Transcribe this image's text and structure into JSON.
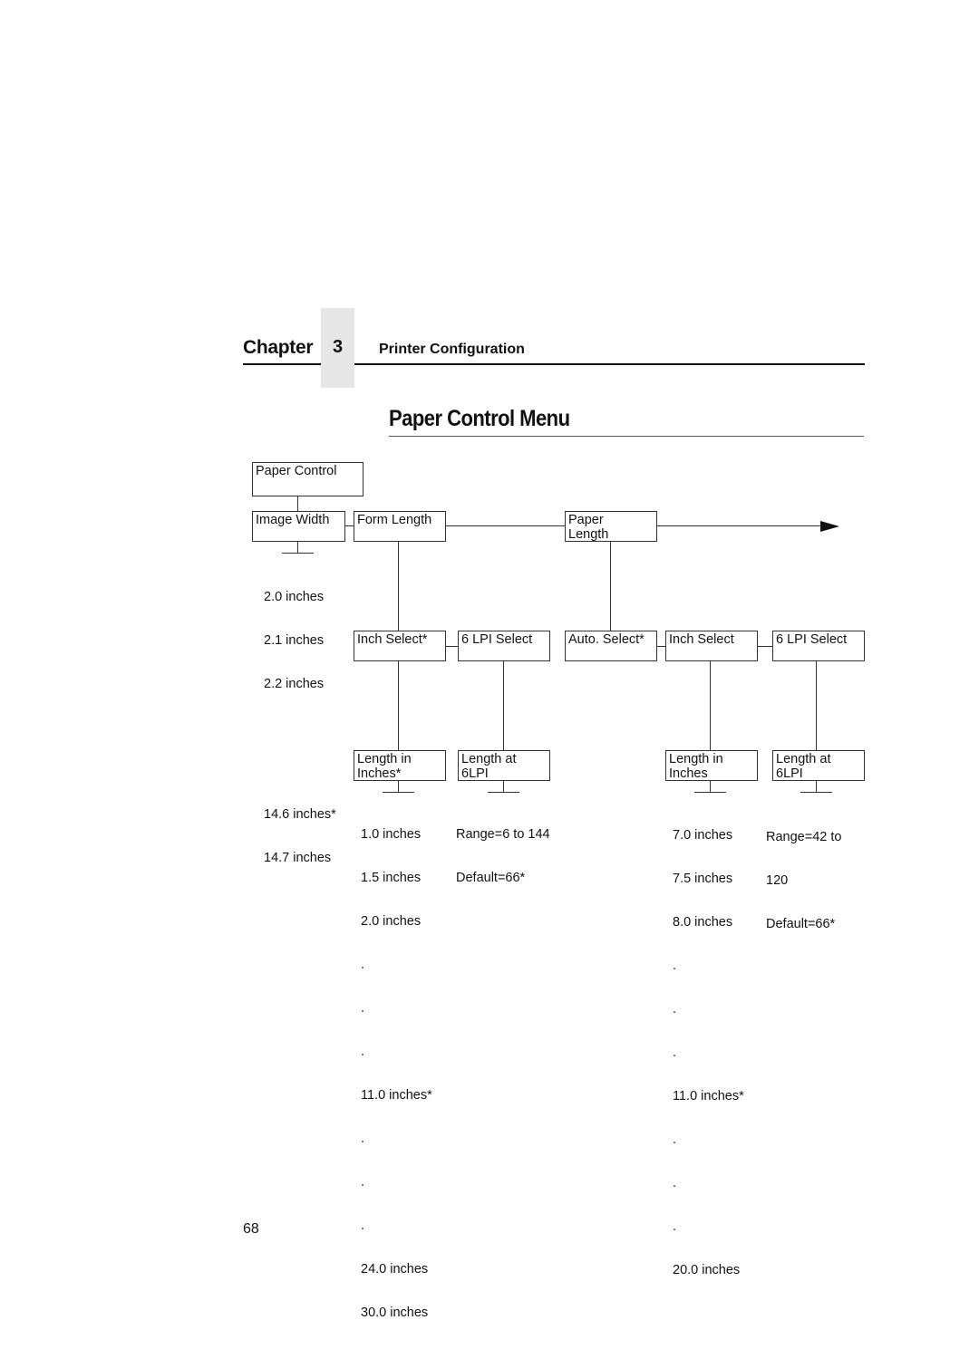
{
  "header": {
    "chapter_label": "Chapter",
    "chapter_number": "3",
    "section_title": "Printer Configuration"
  },
  "page_title": "Paper Control Menu",
  "diagram": {
    "root": "Paper Control",
    "image_width": {
      "label": "Image Width",
      "values": [
        "2.0 inches",
        "2.1 inches",
        "2.2 inches",
        "",
        "",
        "14.6 inches*",
        "14.7 inches"
      ]
    },
    "form_length": {
      "label": "Form Length",
      "inch_select": {
        "label": "Inch Select*",
        "child": "Length in\nInches*",
        "values": [
          "1.0 inches",
          "1.5 inches",
          "2.0 inches",
          ".",
          ".",
          ".",
          "11.0 inches*",
          ".",
          ".",
          ".",
          "24.0 inches",
          "30.0 inches"
        ]
      },
      "lpi_select": {
        "label": "6 LPI Select",
        "child": "Length at\n6LPI",
        "values": [
          "Range=6 to 144",
          "Default=66*"
        ]
      }
    },
    "paper_length": {
      "label": "Paper\nLength",
      "auto_select": {
        "label": "Auto. Select*"
      },
      "inch_select": {
        "label": "Inch Select",
        "child": "Length in\nInches",
        "values": [
          "7.0 inches",
          "7.5 inches",
          "8.0 inches",
          ".",
          ".",
          ".",
          "11.0 inches*",
          ".",
          ".",
          ".",
          "20.0 inches"
        ]
      },
      "lpi_select": {
        "label": "6 LPI Select",
        "child": "Length at\n6LPI",
        "values": [
          "Range=42 to",
          "120",
          "Default=66*"
        ]
      }
    },
    "continue_arrow": "right-arrow"
  },
  "footer": {
    "page_number": "68"
  }
}
